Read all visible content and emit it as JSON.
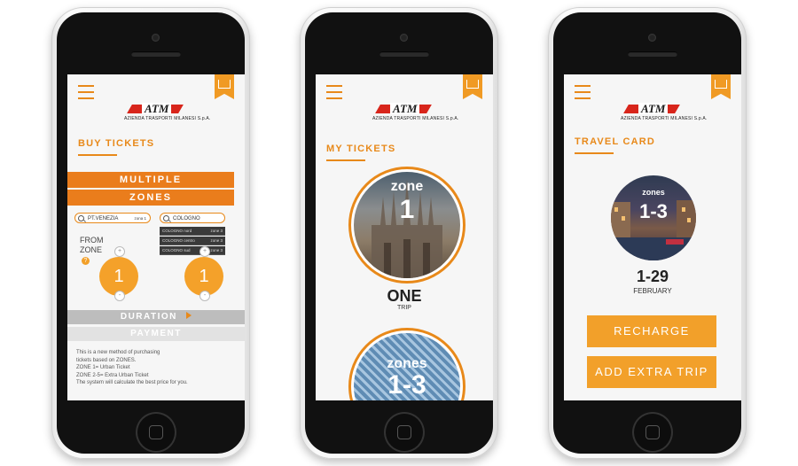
{
  "colors": {
    "accent": "#e8891a",
    "button": "#f2a02a",
    "bar": "#ea7d1c",
    "logo_red": "#d8251b"
  },
  "logo": {
    "text": "ATM",
    "subtitle": "AZIENDA TRASPORTI MILANESI S.p.A."
  },
  "icons": {
    "menu": "hamburger-menu-icon",
    "bookmark": "map-bookmark-icon",
    "search": "search-icon"
  },
  "buy": {
    "title": "BUY TICKETS",
    "bar1": "MULTIPLE",
    "bar2": "ZONES",
    "search_from": {
      "value": "PT.VENEZIA",
      "zone": "zona 1"
    },
    "search_to": {
      "value": "COLOGNO"
    },
    "dropdown": [
      {
        "name": "COLOGNO nord",
        "zone": "zone 3"
      },
      {
        "name": "COLOGNO centro",
        "zone": "zone 3"
      },
      {
        "name": "COLOGNO sud",
        "zone": "zone 3"
      }
    ],
    "from_label": "FROM",
    "zone_label": "ZONE",
    "help": "?",
    "from_value": "1",
    "to_value": "1",
    "plus": "+",
    "minus": "-",
    "duration": "DURATION",
    "payment": "PAYMENT",
    "info_lines": [
      "This is a new method of purchasing",
      "tickets based on ZONES.",
      "ZONE 1= Urban Ticket",
      "ZONE 2-5= Extra Urban Ticket",
      "The system will calculate the best price for you."
    ]
  },
  "mytickets": {
    "title": "MY TICKETS",
    "ticket1": {
      "word": "zone",
      "number": "1",
      "type": "ONE",
      "sub": "TRIP"
    },
    "ticket2": {
      "word": "zones",
      "number": "1-3"
    }
  },
  "travel": {
    "title": "TRAVEL CARD",
    "word": "zones",
    "range": "1-3",
    "dates": "1-29",
    "month": "FEBRUARY",
    "recharge": "RECHARGE",
    "extra": "ADD EXTRA TRIP"
  }
}
